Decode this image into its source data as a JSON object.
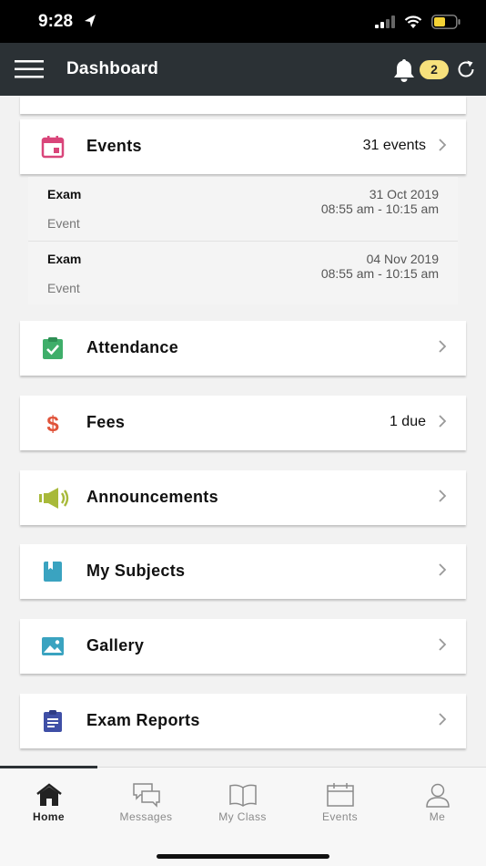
{
  "status_bar": {
    "time": "9:28"
  },
  "header": {
    "title": "Dashboard",
    "notification_count": "2"
  },
  "events": {
    "label": "Events",
    "count_text": "31 events",
    "items": [
      {
        "title": "Exam",
        "type": "Event",
        "date": "31 Oct 2019",
        "time": "08:55 am - 10:15 am"
      },
      {
        "title": "Exam",
        "type": "Event",
        "date": "04 Nov 2019",
        "time": "08:55 am - 10:15 am"
      }
    ]
  },
  "cards": [
    {
      "label": "Attendance",
      "meta": ""
    },
    {
      "label": "Fees",
      "meta": "1 due"
    },
    {
      "label": "Announcements",
      "meta": ""
    },
    {
      "label": "My Subjects",
      "meta": ""
    },
    {
      "label": "Gallery",
      "meta": ""
    },
    {
      "label": "Exam Reports",
      "meta": ""
    }
  ],
  "tabs": [
    {
      "label": "Home"
    },
    {
      "label": "Messages"
    },
    {
      "label": "My Class"
    },
    {
      "label": "Events"
    },
    {
      "label": "Me"
    }
  ],
  "colors": {
    "header_bg": "#2b3135",
    "badge": "#f7e17c",
    "events_icon": "#d9457a",
    "attendance_icon": "#3fae6a",
    "fees_icon": "#e0533a",
    "announcements_icon": "#a8b93a",
    "subjects_icon": "#3aa3c0",
    "gallery_icon": "#3aa3c0",
    "exam_reports_icon": "#3f4fa6"
  }
}
